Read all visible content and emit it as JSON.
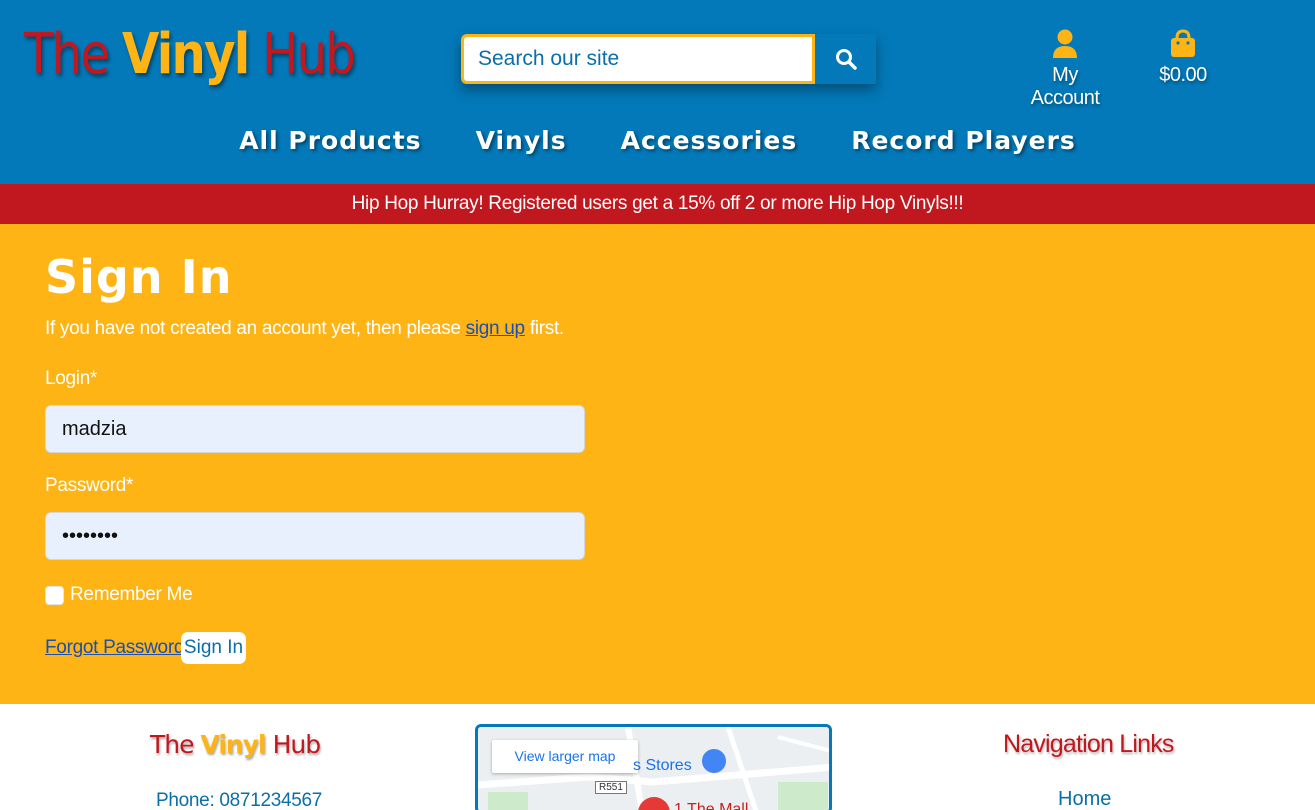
{
  "header": {
    "logo": {
      "part1": "The",
      "part2": "Vinyl",
      "part3": "Hub"
    },
    "search": {
      "placeholder": "Search our site"
    },
    "account_label": "My Account",
    "cart_total": "$0.00",
    "nav": [
      "All Products",
      "Vinyls",
      "Accessories",
      "Record Players"
    ]
  },
  "banner": {
    "text": "Hip Hop Hurray! Registered users get a 15% off 2 or more Hip Hop Vinyls!!!"
  },
  "signin": {
    "title": "Sign In",
    "intro_before": "If you have not created an account yet, then please",
    "intro_link": "sign up",
    "intro_after": "first.",
    "login_label": "Login*",
    "login_value": "madzia",
    "password_label": "Password*",
    "password_value": "••••••••",
    "remember_label": "Remember Me",
    "forgot_label": "Forgot Password?",
    "submit_label": "Sign In"
  },
  "footer": {
    "brand": {
      "part1": "The",
      "part2": "Vinyl",
      "part3": "Hub"
    },
    "phone": "Phone: 0871234567",
    "map": {
      "larger_map_label": "View larger map",
      "place_label": "s Stores",
      "road_label": "R551",
      "pin_label": "1 The Mall"
    },
    "nav_title": "Navigation Links",
    "nav_home": "Home"
  },
  "colors": {
    "header_blue": "#0379b9",
    "brand_red": "#c1181f",
    "brand_yellow": "#fdb414",
    "link_blue": "#1a4fb5"
  },
  "icons": {
    "search": "search-icon",
    "account": "user-icon",
    "cart": "shopping-bag-icon"
  }
}
